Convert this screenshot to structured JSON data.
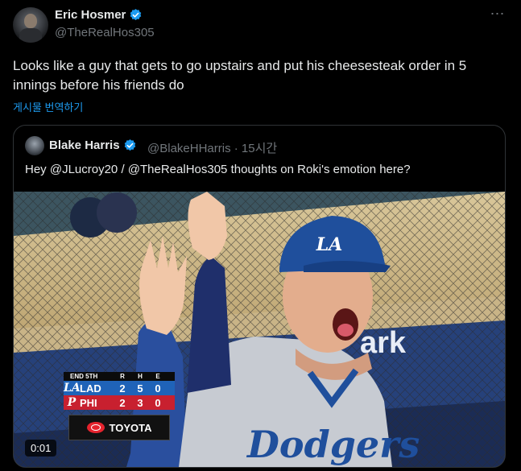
{
  "tweet": {
    "author_name": "Eric Hosmer",
    "author_handle": "@TheRealHos305",
    "more_icon": "⋯",
    "text": "Looks like a guy that gets to go upstairs and put his cheesesteak order in 5 innings before his friends do",
    "translate_label": "게시물 번역하기"
  },
  "quote": {
    "author_name": "Blake Harris",
    "author_handle": "@BlakeHHarris",
    "time": "· 15시간",
    "text": "Hey @JLucroy20 / @TheRealHos305 thoughts on Roki's emotion here?",
    "video_time": "0:01",
    "scorebug": {
      "inning": "END 5TH",
      "headers": [
        "R",
        "H",
        "E"
      ],
      "teams": [
        {
          "logo": "LA",
          "name": "LAD",
          "r": "2",
          "h": "5",
          "e": "0"
        },
        {
          "logo": "P",
          "name": "PHI",
          "r": "2",
          "h": "3",
          "e": "0"
        }
      ],
      "sponsor": "TOYOTA"
    },
    "video_text": {
      "cap_logo": "LA",
      "jersey": "Dodgers",
      "wall": "ark"
    }
  },
  "colors": {
    "verified": "#1d9bf0",
    "link": "#1d9bf0",
    "muted": "#71767b",
    "dodger_blue": "#1f4f9c"
  }
}
